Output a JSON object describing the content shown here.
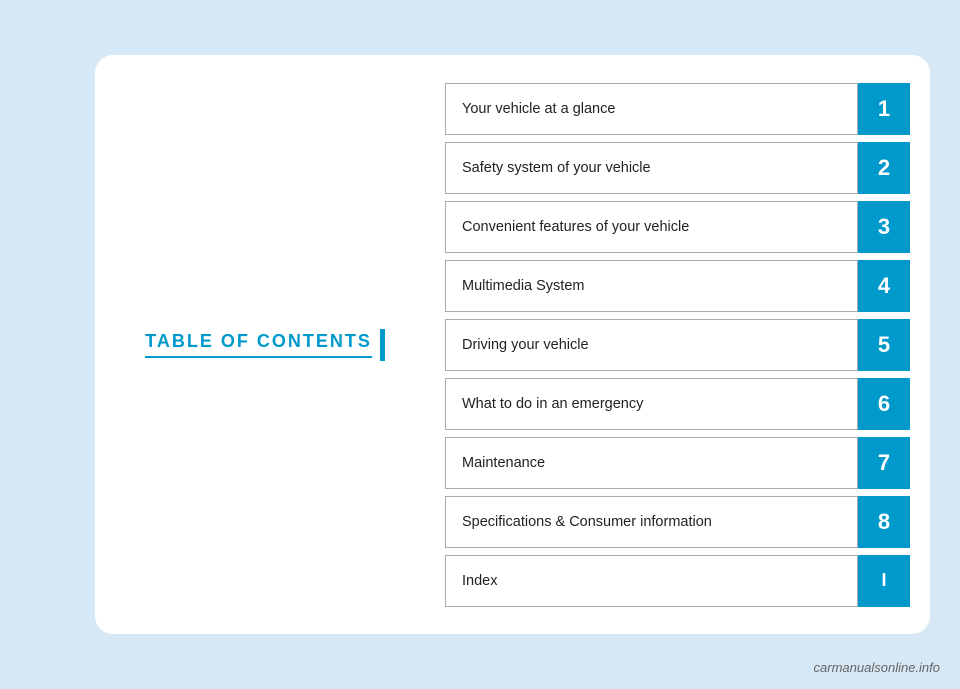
{
  "page": {
    "background_color": "#d6e8f5",
    "accent_color": "#0099cc"
  },
  "toc": {
    "title": "TABLE OF CONTENTS",
    "items": [
      {
        "label": "Your vehicle at a glance",
        "number": "1"
      },
      {
        "label": "Safety system of your vehicle",
        "number": "2"
      },
      {
        "label": "Convenient features of your vehicle",
        "number": "3"
      },
      {
        "label": "Multimedia System",
        "number": "4"
      },
      {
        "label": "Driving your vehicle",
        "number": "5"
      },
      {
        "label": "What to do in an emergency",
        "number": "6"
      },
      {
        "label": "Maintenance",
        "number": "7"
      },
      {
        "label": "Specifications & Consumer information",
        "number": "8"
      },
      {
        "label": "Index",
        "number": "I"
      }
    ]
  },
  "footer": {
    "watermark": "carmanualsonline.info"
  }
}
